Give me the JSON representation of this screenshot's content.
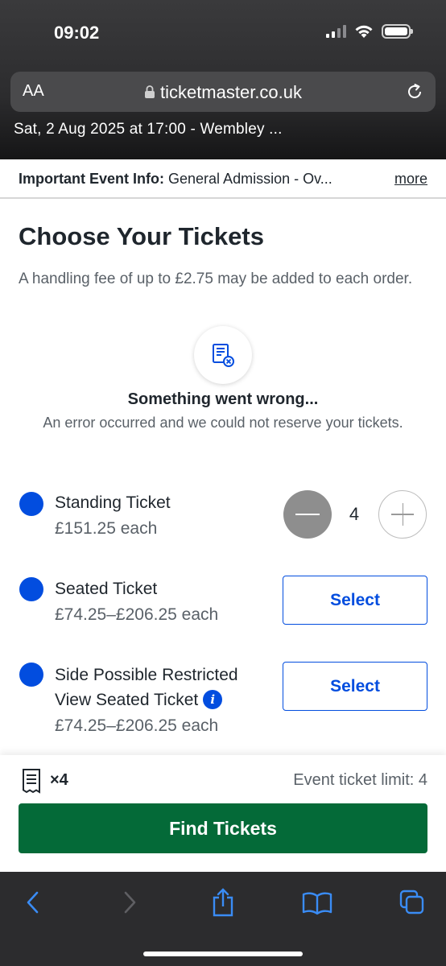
{
  "status_bar": {
    "time": "09:02"
  },
  "browser": {
    "aa_label": "AA",
    "url": "ticketmaster.co.uk",
    "event_strip": "Sat, 2 Aug 2025 at 17:00 -  Wembley ..."
  },
  "info_bar": {
    "label": "Important Event Info:",
    "text": "General Admission - Ov...",
    "more": "more"
  },
  "main": {
    "title": "Choose Your Tickets",
    "fee_note": "A handling fee of up to £2.75 may be added to each order.",
    "error": {
      "title": "Something went wrong...",
      "message": "An error occurred and we could not reserve your tickets."
    },
    "tickets": [
      {
        "name": "Standing Ticket",
        "price": "£151.25 each",
        "quantity": "4"
      },
      {
        "name": "Seated Ticket",
        "price": "£74.25–£206.25 each",
        "button": "Select"
      },
      {
        "name_line1": "Side Possible Restricted",
        "name_line2": "View Seated Ticket",
        "price": "£74.25–£206.25 each",
        "button": "Select",
        "info_glyph": "i"
      }
    ]
  },
  "footer": {
    "ticket_count": "×4",
    "limit": "Event ticket limit: 4",
    "find_button": "Find Tickets"
  },
  "colors": {
    "accent_blue": "#024ddf",
    "find_green": "#046a38",
    "stepper_minus": "#8e8e8e"
  },
  "icons": {
    "status": [
      "signal-icon",
      "wifi-icon",
      "battery-icon"
    ],
    "toolbar": [
      "back-icon",
      "forward-icon",
      "share-icon",
      "bookmarks-icon",
      "tabs-icon"
    ]
  }
}
